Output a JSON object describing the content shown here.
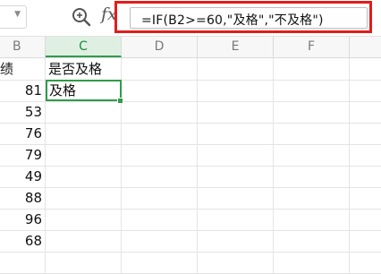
{
  "formula_bar": {
    "name_box_value": "",
    "formula": "=IF(B2>=60,\"及格\",\"不及格\")",
    "fx_label": "fx",
    "highlight_color": "#e21c1c"
  },
  "columns": [
    "B",
    "C",
    "D",
    "E",
    "F"
  ],
  "selected_column": "C",
  "sheet": {
    "b_header_fragment": "绩",
    "c_header": "是否及格",
    "c2_value": "及格",
    "scores": [
      "81",
      "53",
      "76",
      "79",
      "49",
      "88",
      "96",
      "68"
    ]
  },
  "colors": {
    "selection_green": "#2e9c4a",
    "header_bg": "#f7f7f7"
  }
}
